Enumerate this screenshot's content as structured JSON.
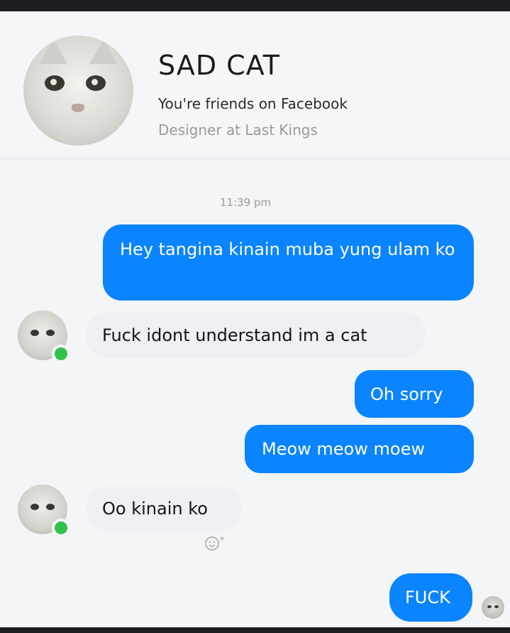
{
  "contact": {
    "name": "SAD CAT",
    "friendship": "You're friends on Facebook",
    "occupation": "Designer at Last Kings"
  },
  "thread": {
    "timestamp": "11:39 pm",
    "messages": [
      {
        "from": "me",
        "text": "Hey tangina kinain muba yung ulam ko"
      },
      {
        "from": "contact",
        "text": "Fuck idont understand im a cat"
      },
      {
        "from": "me",
        "text": "Oh sorry"
      },
      {
        "from": "me",
        "text": "Meow meow moew"
      },
      {
        "from": "contact",
        "text": "Oo kinain ko"
      },
      {
        "from": "me",
        "text": "FUCK"
      }
    ]
  },
  "icons": {
    "react": "smiley-plus-icon",
    "online": "online-status-icon"
  },
  "colors": {
    "outgoing_bubble": "#0a84ff",
    "incoming_bubble": "#f1eef4",
    "online": "#31c24a"
  }
}
